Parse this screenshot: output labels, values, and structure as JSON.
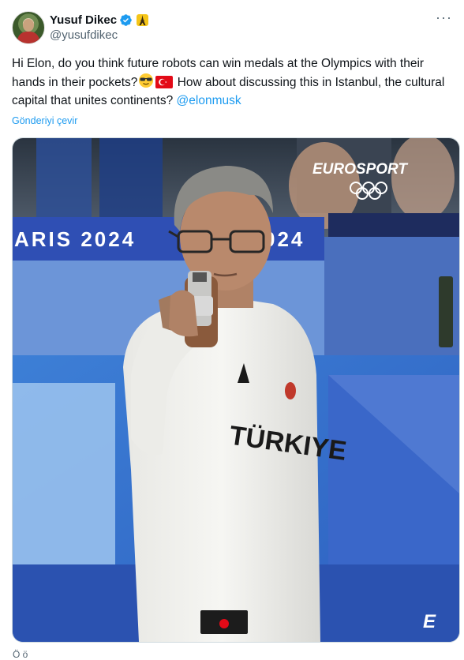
{
  "user": {
    "display_name": "Yusuf Dikec",
    "handle": "@yusufdikec",
    "affiliation_icon": "eiffel-tower-icon"
  },
  "tweet": {
    "text_before_emoji": "Hi Elon, do you think future robots can win medals at the Olympics with their hands in their pockets?",
    "emojis": [
      "smiling-face-with-sunglasses",
      "turkey-flag"
    ],
    "text_after_emoji": " How about discussing this in Istanbul, the cultural capital that unites continents? ",
    "mention": "@elonmusk",
    "translate_label": "Gönderiyi çevir"
  },
  "media": {
    "broadcaster": "EUROSPORT",
    "banner_left": "ARIS 2024",
    "banner_right": "024",
    "shirt_text": "TÜRKIYE",
    "corner_logo": "E"
  },
  "colors": {
    "link": "#1d9bf0",
    "verified": "#1d9bf0",
    "secondary_text": "#536471",
    "banner_blue": "#2f4fb4"
  },
  "footer_cut": "Ö        ö"
}
